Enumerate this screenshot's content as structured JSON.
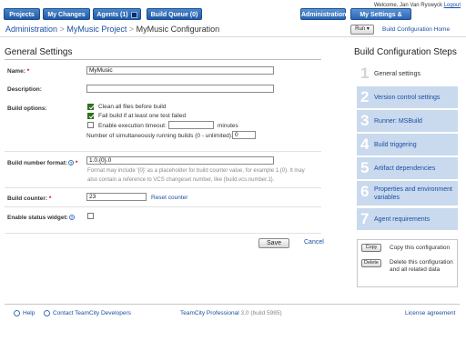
{
  "header": {
    "tabs": [
      "Projects",
      "My Changes",
      "Agents (1)",
      "Build Queue (0)"
    ],
    "welcome_prefix": "Welcome, Jan Van Ryswyck",
    "logout": "Logout",
    "admin": "Administration",
    "settings": "My Settings & Tools"
  },
  "breadcrumb": {
    "items": [
      "Administration",
      "MyMusic Project",
      "MyMusic Configuration"
    ],
    "separator": ">",
    "run": "Run",
    "home_link": "Build Configuration Home"
  },
  "general": {
    "title": "General Settings",
    "name_label": "Name:",
    "name_value": "MyMusic",
    "description_label": "Description:",
    "description_value": "",
    "build_options_label": "Build options:",
    "opt_clean": "Clean all files before build",
    "opt_fail": "Fail build if at least one test failed",
    "opt_timeout": "Enable execution timeout:",
    "timeout_unit": "minutes",
    "running_builds": "Number of simultaneously running builds (0 - unlimited):",
    "running_builds_value": "0",
    "build_number_label": "Build number format:",
    "build_number_value": "1.0.{0}.0",
    "build_number_hint": "Format may include '{0}' as a placeholder for build counter value, for example 1.{0}. It may also contain a reference to VCS changeset number, like {build.vcs.number.1}.",
    "build_counter_label": "Build counter:",
    "build_counter_value": "23",
    "reset_counter": "Reset counter",
    "status_widget_label": "Enable status widget:",
    "save": "Save",
    "cancel": "Cancel"
  },
  "steps": {
    "title": "Build Configuration Steps",
    "items": [
      {
        "num": "1",
        "label": "General settings"
      },
      {
        "num": "2",
        "label": "Version control settings"
      },
      {
        "num": "3",
        "label": "Runner: MSBuild"
      },
      {
        "num": "4",
        "label": "Build triggering"
      },
      {
        "num": "5",
        "label": "Artifact dependencies"
      },
      {
        "num": "6",
        "label": "Properties and environment variables"
      },
      {
        "num": "7",
        "label": "Agent requirements"
      }
    ],
    "copy_btn": "Copy",
    "copy_text": "Copy this configuration",
    "delete_btn": "Delete",
    "delete_text": "Delete this configuration and all related data"
  },
  "footer": {
    "help": "Help",
    "contact": "Contact TeamCity Developers",
    "product": "TeamCity Professional",
    "version": "3.0 (build 5985)",
    "license": "License agreement"
  }
}
